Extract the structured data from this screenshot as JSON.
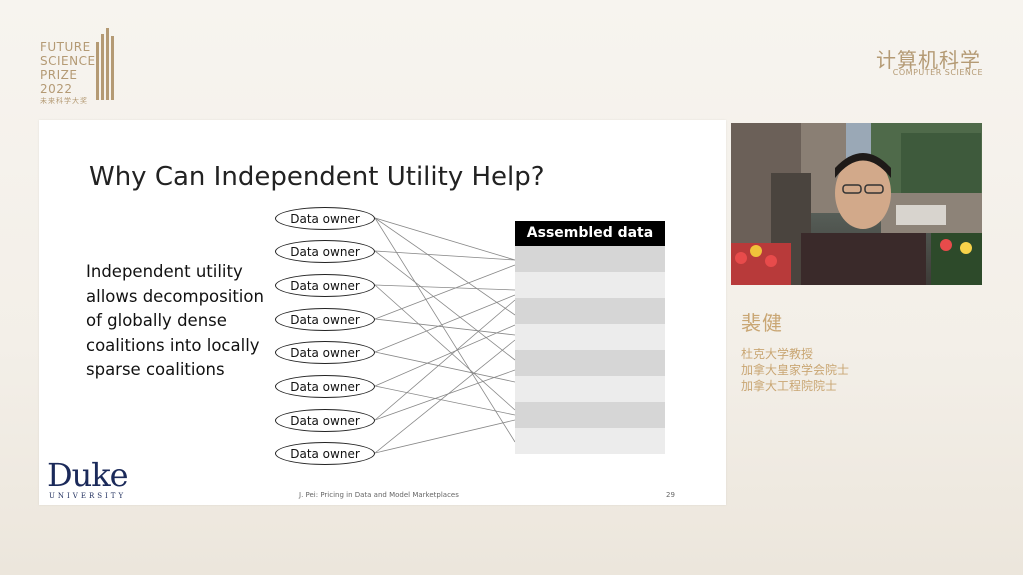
{
  "logo": {
    "lines": [
      "FUTURE",
      "SCIENCE",
      "PRIZE",
      "2022"
    ],
    "zh": "未来科学大奖"
  },
  "category": {
    "zh": "计算机科学",
    "en": "COMPUTER SCIENCE"
  },
  "slide": {
    "title": "Why Can Independent Utility Help?",
    "body": "Independent utility allows decomposition of globally dense coalitions into locally sparse coalitions",
    "owners": [
      "Data owner",
      "Data owner",
      "Data owner",
      "Data owner",
      "Data owner",
      "Data owner",
      "Data owner",
      "Data owner"
    ],
    "assembled_header": "Assembled data",
    "assembled_row_count": 8,
    "footer": "J. Pei: Pricing in Data and Model Marketplaces",
    "page": "29",
    "duke_main": "Duke",
    "duke_sub": "UNIVERSITY"
  },
  "speaker": {
    "name": "裴健",
    "titles": [
      "杜克大学教授",
      "加拿大皇家学会院士",
      "加拿大工程院院士"
    ]
  },
  "colors": {
    "gold": "#b49a74",
    "duke_blue": "#1b2a5a"
  }
}
